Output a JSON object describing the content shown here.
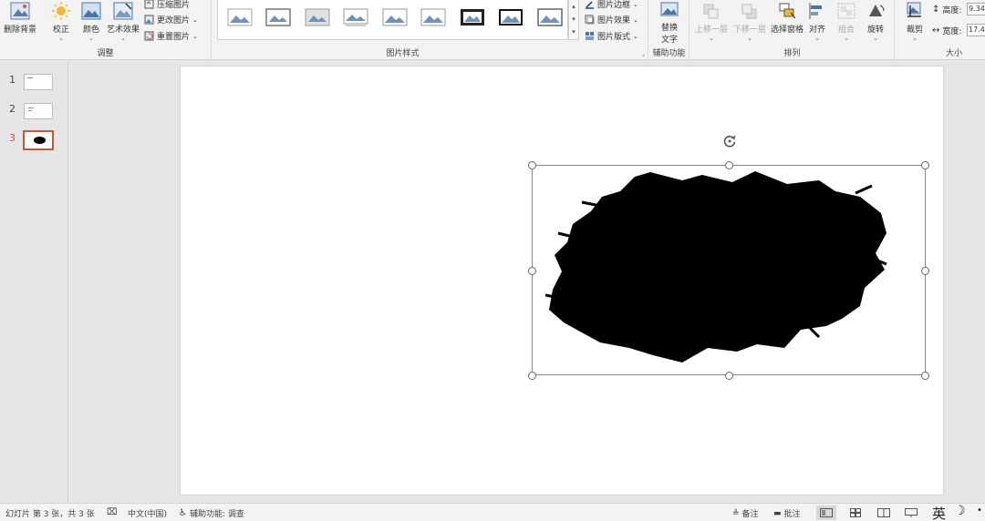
{
  "ribbon": {
    "adjust": {
      "label": "调整",
      "remove_bg": "删除背景",
      "corrections": "校正",
      "color": "颜色",
      "artistic": "艺术效果",
      "compress": "压缩图片",
      "change": "更改图片",
      "reset": "重置图片"
    },
    "styles": {
      "label": "图片样式",
      "border": "图片边框",
      "effects": "图片效果",
      "layout": "图片版式"
    },
    "accessibility": {
      "label": "辅助功能",
      "alt_text_1": "替换",
      "alt_text_2": "文字"
    },
    "arrange": {
      "label": "排列",
      "bring_forward": "上移一层",
      "send_backward": "下移一层",
      "selection_pane": "选择窗格",
      "align": "对齐",
      "group": "组合",
      "rotate": "旋转"
    },
    "size": {
      "label": "大小",
      "crop": "裁剪",
      "height_label": "高度:",
      "height_value": "9.34",
      "width_label": "宽度:",
      "width_value": "17.4"
    }
  },
  "thumbnails": [
    {
      "num": "1"
    },
    {
      "num": "2"
    },
    {
      "num": "3"
    }
  ],
  "statusbar": {
    "slide_info": "幻灯片 第 3 张，共 3 张",
    "language": "中文(中国)",
    "accessibility": "辅助功能: 调查",
    "notes": "备注",
    "comments": "批注",
    "ime": "英"
  },
  "colors": {
    "accent": "#c55a3a",
    "ribbon_bg": "#f3f3f3",
    "canvas_bg": "#e6e6e6"
  }
}
